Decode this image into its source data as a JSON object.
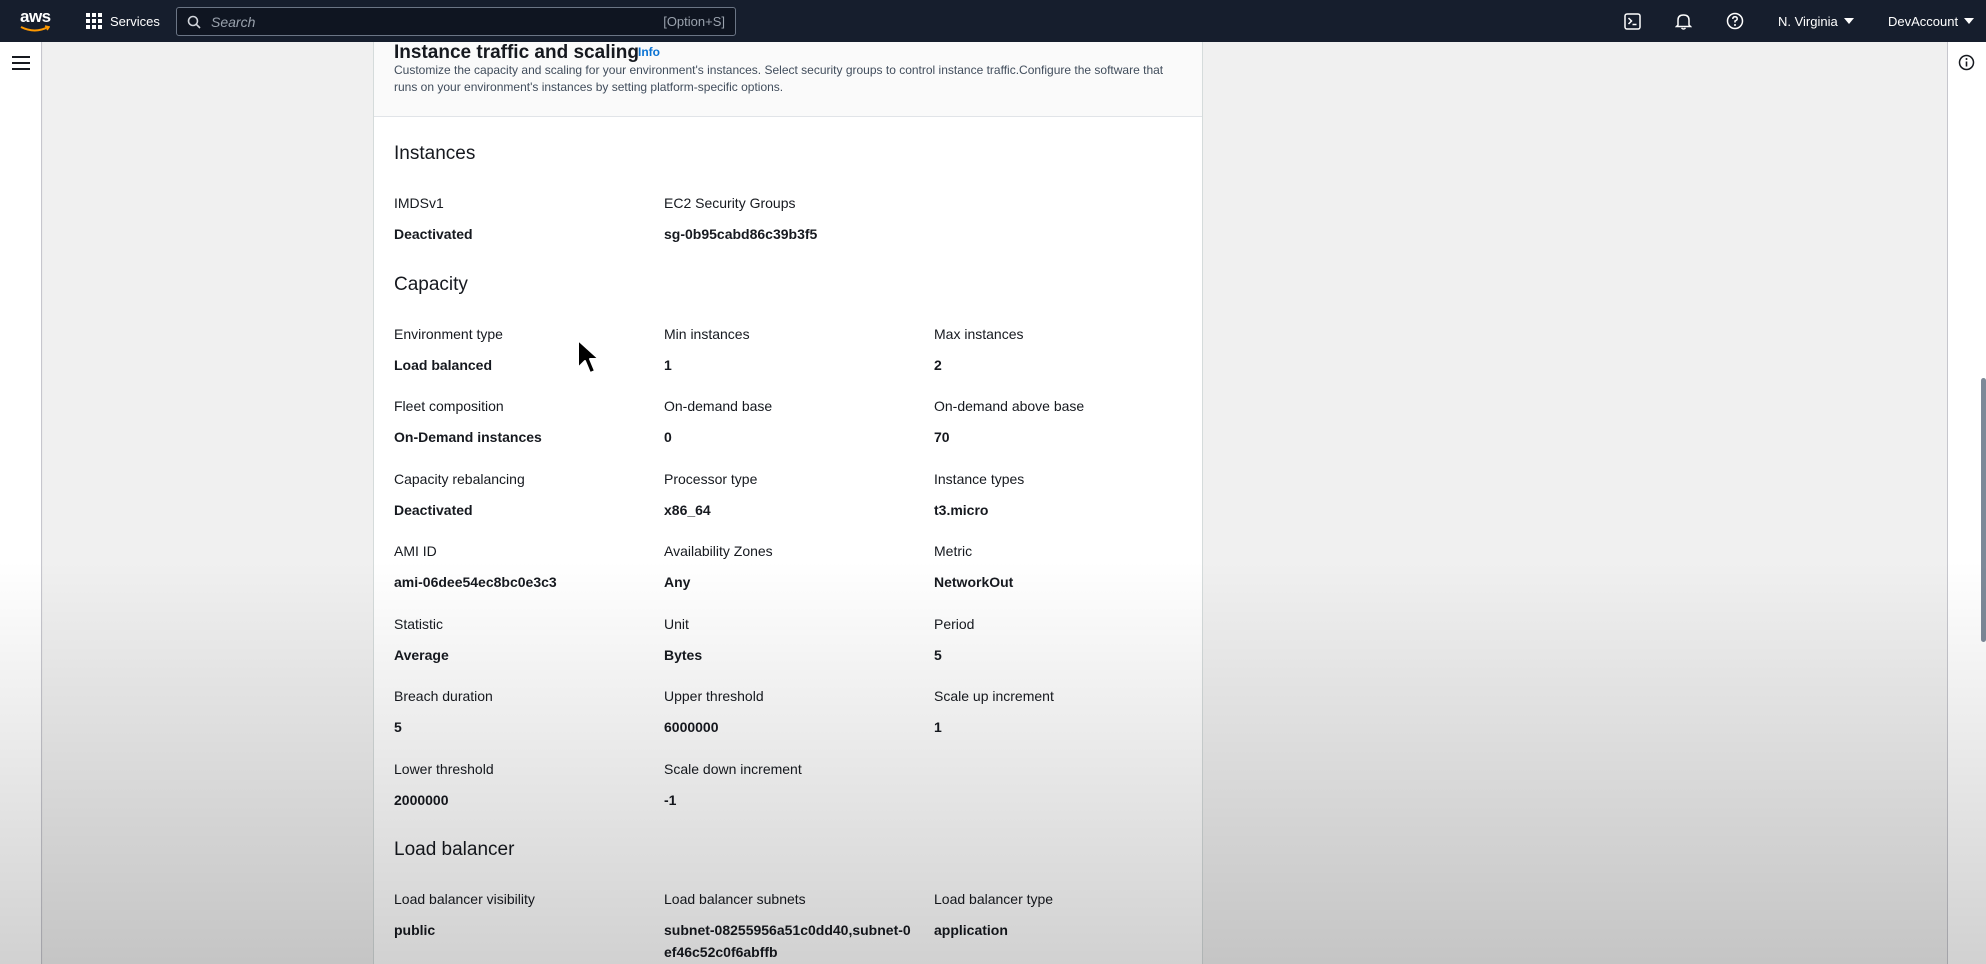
{
  "topnav": {
    "logo": "aws",
    "services_label": "Services",
    "search_placeholder": "Search",
    "search_shortcut": "[Option+S]",
    "region": "N. Virginia",
    "account": "DevAccount",
    "icons": [
      "cloudshell-icon",
      "bell-icon",
      "help-icon"
    ]
  },
  "panel": {
    "title": "Instance traffic and scaling",
    "info_label": "Info",
    "description": "Customize the capacity and scaling for your environment's instances. Select security groups to control instance traffic.Configure the software that runs on your environment's instances by setting platform-specific options."
  },
  "sections": {
    "instances": {
      "title": "Instances",
      "fields": [
        {
          "key": "IMDSv1",
          "value": "Deactivated"
        },
        {
          "key": "EC2 Security Groups",
          "value": "sg-0b95cabd86c39b3f5"
        }
      ]
    },
    "capacity": {
      "title": "Capacity",
      "fields": [
        {
          "key": "Environment type",
          "value": "Load balanced"
        },
        {
          "key": "Min instances",
          "value": "1"
        },
        {
          "key": "Max instances",
          "value": "2"
        },
        {
          "key": "Fleet composition",
          "value": "On-Demand instances"
        },
        {
          "key": "On-demand base",
          "value": "0"
        },
        {
          "key": "On-demand above base",
          "value": "70"
        },
        {
          "key": "Capacity rebalancing",
          "value": "Deactivated"
        },
        {
          "key": "Processor type",
          "value": "x86_64"
        },
        {
          "key": "Instance types",
          "value": "t3.micro"
        },
        {
          "key": "AMI ID",
          "value": "ami-06dee54ec8bc0e3c3"
        },
        {
          "key": "Availability Zones",
          "value": "Any"
        },
        {
          "key": "Metric",
          "value": "NetworkOut"
        },
        {
          "key": "Statistic",
          "value": "Average"
        },
        {
          "key": "Unit",
          "value": "Bytes"
        },
        {
          "key": "Period",
          "value": "5"
        },
        {
          "key": "Breach duration",
          "value": "5"
        },
        {
          "key": "Upper threshold",
          "value": "6000000"
        },
        {
          "key": "Scale up increment",
          "value": "1"
        },
        {
          "key": "Lower threshold",
          "value": "2000000"
        },
        {
          "key": "Scale down increment",
          "value": "-1"
        }
      ]
    },
    "load_balancer": {
      "title": "Load balancer",
      "fields": [
        {
          "key": "Load balancer visibility",
          "value": "public"
        },
        {
          "key": "Load balancer subnets",
          "value": "subnet-08255956a51c0dd40,subnet-0ef46c52c0f6abffb"
        },
        {
          "key": "Load balancer type",
          "value": "application"
        }
      ]
    }
  },
  "colors": {
    "nav_bg": "#161e2d",
    "link": "#0972d3",
    "text": "#16191f"
  }
}
